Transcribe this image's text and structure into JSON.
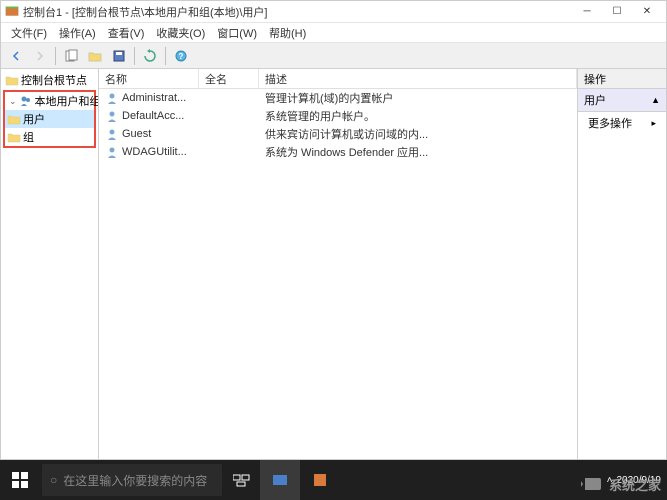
{
  "titlebar": {
    "title": "控制台1 - [控制台根节点\\本地用户和组(本地)\\用户]"
  },
  "menu": {
    "file": "文件(F)",
    "action": "操作(A)",
    "view": "查看(V)",
    "favorites": "收藏夹(O)",
    "window": "窗口(W)",
    "help": "帮助(H)"
  },
  "tree": {
    "root": "控制台根节点",
    "localusers": "本地用户和组(本地)",
    "users": "用户",
    "groups": "组"
  },
  "list": {
    "headers": {
      "name": "名称",
      "fullname": "全名",
      "desc": "描述"
    },
    "rows": [
      {
        "name": "Administrat...",
        "fullname": "",
        "desc": "管理计算机(域)的内置帐户"
      },
      {
        "name": "DefaultAcc...",
        "fullname": "",
        "desc": "系统管理的用户帐户。"
      },
      {
        "name": "Guest",
        "fullname": "",
        "desc": "供来宾访问计算机或访问域的内..."
      },
      {
        "name": "WDAGUtilit...",
        "fullname": "",
        "desc": "系统为 Windows Defender 应用..."
      }
    ]
  },
  "actions": {
    "title": "操作",
    "section": "用户",
    "more": "更多操作"
  },
  "taskbar": {
    "search_placeholder": "在这里输入你要搜索的内容",
    "date": "2020/9/19"
  },
  "watermark": "系统之家"
}
